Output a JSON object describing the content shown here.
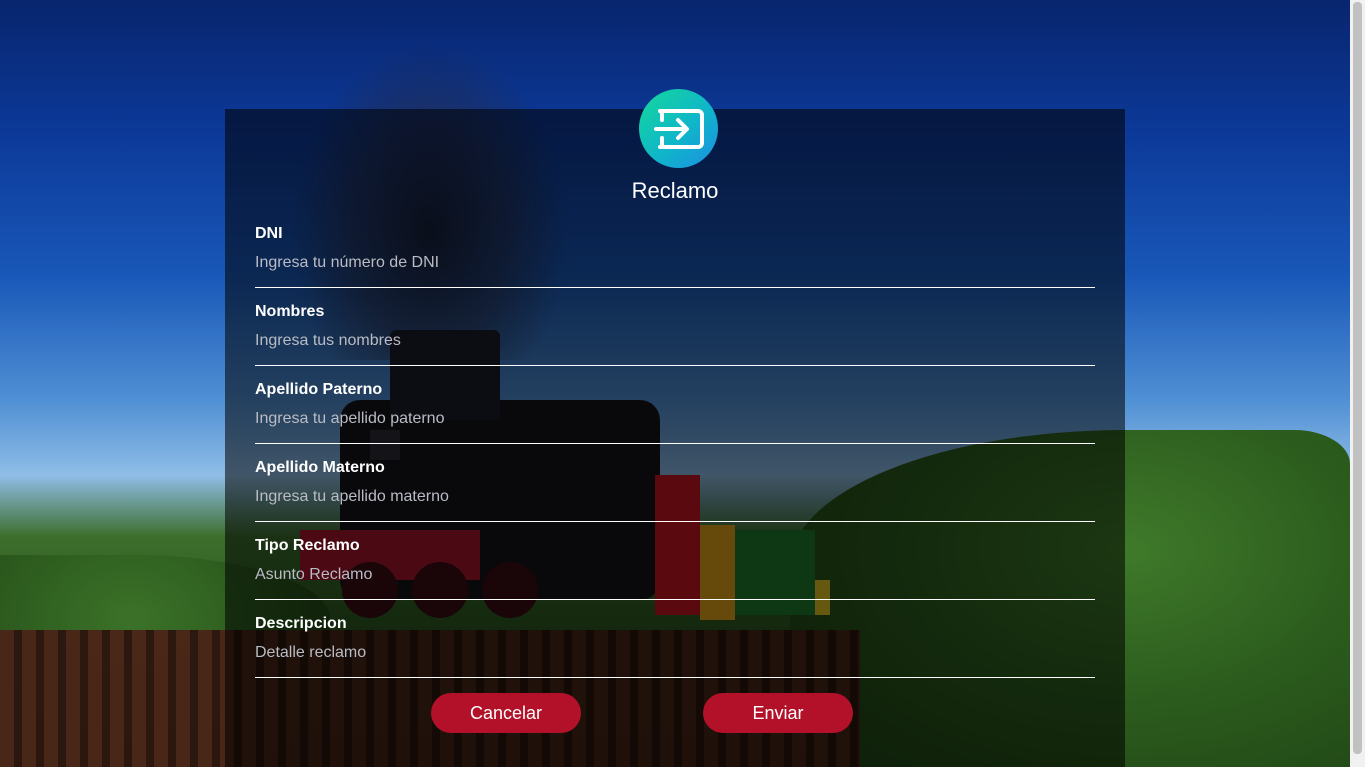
{
  "form": {
    "title": "Reclamo",
    "logo_icon": "login-arrow-icon",
    "fields": [
      {
        "label": "DNI",
        "placeholder": "Ingresa tu número de DNI",
        "value": ""
      },
      {
        "label": "Nombres",
        "placeholder": "Ingresa tus nombres",
        "value": ""
      },
      {
        "label": "Apellido Paterno",
        "placeholder": "Ingresa tu apellido paterno",
        "value": ""
      },
      {
        "label": "Apellido Materno",
        "placeholder": "Ingresa tu apellido materno",
        "value": ""
      },
      {
        "label": "Tipo Reclamo",
        "placeholder": "Asunto Reclamo",
        "value": ""
      },
      {
        "label": "Descripcion",
        "placeholder": "Detalle reclamo",
        "value": ""
      }
    ],
    "buttons": {
      "cancel_label": "Cancelar",
      "submit_label": "Enviar"
    }
  },
  "colors": {
    "button_bg": "#b3112a",
    "logo_gradient_start": "#14d99a",
    "logo_gradient_end": "#1b8ee3",
    "panel_overlay": "rgba(0,0,0,0.55)"
  },
  "background": {
    "scene": "steam-train-on-bridge-photo"
  }
}
